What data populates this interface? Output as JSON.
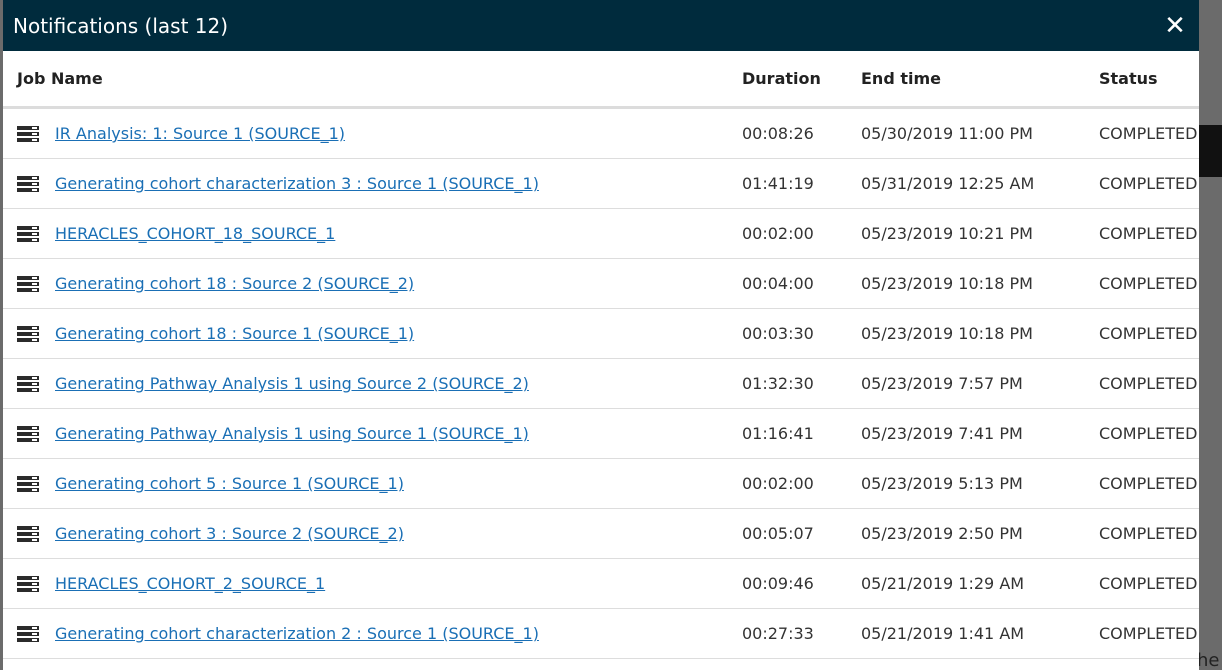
{
  "modal": {
    "title": "Notifications (last 12)",
    "close_label": "✕"
  },
  "table": {
    "columns": [
      "Job Name",
      "Duration",
      "End time",
      "Status"
    ],
    "rows": [
      {
        "name": "IR Analysis: 1: Source 1 (SOURCE_1)",
        "duration": "00:08:26",
        "end_time": "05/30/2019 11:00 PM",
        "status": "COMPLETED"
      },
      {
        "name": "Generating cohort characterization 3 : Source 1 (SOURCE_1)",
        "duration": "01:41:19",
        "end_time": "05/31/2019 12:25 AM",
        "status": "COMPLETED"
      },
      {
        "name": "HERACLES_COHORT_18_SOURCE_1",
        "duration": "00:02:00",
        "end_time": "05/23/2019 10:21 PM",
        "status": "COMPLETED"
      },
      {
        "name": "Generating cohort 18 : Source 2 (SOURCE_2)",
        "duration": "00:04:00",
        "end_time": "05/23/2019 10:18 PM",
        "status": "COMPLETED"
      },
      {
        "name": "Generating cohort 18 : Source 1 (SOURCE_1)",
        "duration": "00:03:30",
        "end_time": "05/23/2019 10:18 PM",
        "status": "COMPLETED"
      },
      {
        "name": "Generating Pathway Analysis 1 using Source 2 (SOURCE_2)",
        "duration": "01:32:30",
        "end_time": "05/23/2019 7:57 PM",
        "status": "COMPLETED"
      },
      {
        "name": "Generating Pathway Analysis 1 using Source 1 (SOURCE_1)",
        "duration": "01:16:41",
        "end_time": "05/23/2019 7:41 PM",
        "status": "COMPLETED"
      },
      {
        "name": "Generating cohort 5 : Source 1 (SOURCE_1)",
        "duration": "00:02:00",
        "end_time": "05/23/2019 5:13 PM",
        "status": "COMPLETED"
      },
      {
        "name": "Generating cohort 3 : Source 2 (SOURCE_2)",
        "duration": "00:05:07",
        "end_time": "05/23/2019 2:50 PM",
        "status": "COMPLETED"
      },
      {
        "name": "HERACLES_COHORT_2_SOURCE_1",
        "duration": "00:09:46",
        "end_time": "05/21/2019 1:29 AM",
        "status": "COMPLETED"
      },
      {
        "name": "Generating cohort characterization 2 : Source 1 (SOURCE_1)",
        "duration": "00:27:33",
        "end_time": "05/21/2019 1:41 AM",
        "status": "COMPLETED"
      }
    ]
  },
  "background": {
    "partial_text": "he"
  },
  "icons": {
    "row_icon": "server-icon",
    "close_icon": "close-icon"
  },
  "colors": {
    "header_bg": "#002b3d",
    "link": "#1a6fb5"
  }
}
